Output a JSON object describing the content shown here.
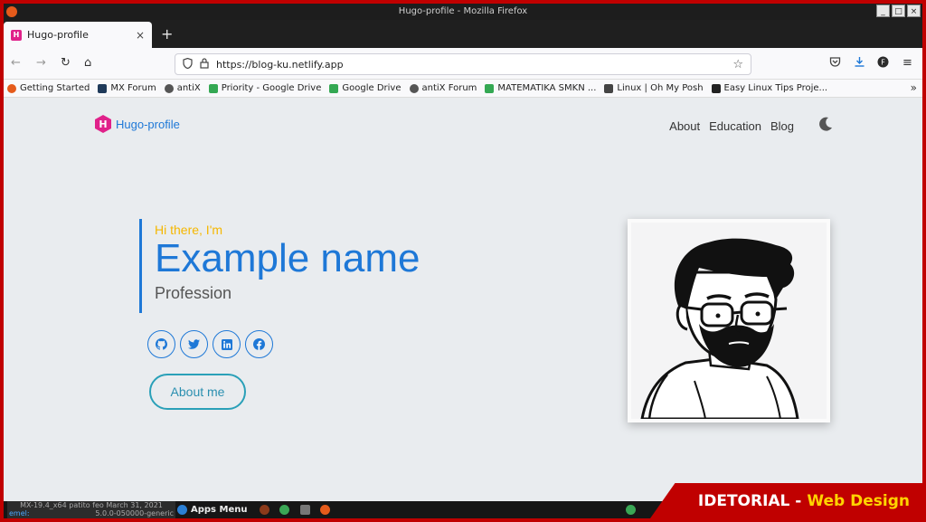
{
  "window": {
    "title": "Hugo-profile - Mozilla Firefox",
    "minimize": "_",
    "maximize": "□",
    "close": "×"
  },
  "tab": {
    "title": "Hugo-profile",
    "favicon_letter": "H",
    "close": "×",
    "new_tab": "+"
  },
  "nav": {
    "back": "←",
    "forward": "→",
    "reload": "↻",
    "home": "⌂",
    "url": "https://blog-ku.netlify.app",
    "menu": "≡"
  },
  "bookmarks": [
    {
      "label": "Getting Started",
      "icon": "firefox-icon",
      "color": "#e55b1b"
    },
    {
      "label": "MX Forum",
      "icon": "mx-icon",
      "color": "#1f3a5a"
    },
    {
      "label": "antiX",
      "icon": "globe-icon",
      "color": "#555555"
    },
    {
      "label": "Priority - Google Drive",
      "icon": "drive-icon",
      "color": "#34a853"
    },
    {
      "label": "Google Drive",
      "icon": "drive-icon",
      "color": "#34a853"
    },
    {
      "label": "antiX Forum",
      "icon": "globe-icon",
      "color": "#555555"
    },
    {
      "label": "MATEMATIKA SMKN ...",
      "icon": "drive-icon",
      "color": "#34a853"
    },
    {
      "label": "Linux | Oh My Posh",
      "icon": "terminal-icon",
      "color": "#444444"
    },
    {
      "label": "Easy Linux Tips Proje...",
      "icon": "tux-icon",
      "color": "#222222"
    }
  ],
  "bookmarks_more": "»",
  "site": {
    "brand": "Hugo-profile",
    "brand_letter": "H",
    "menu": [
      "About",
      "Education",
      "Blog"
    ],
    "greeting": "Hi there, I'm",
    "name": "Example name",
    "profession": "Profession",
    "socials": [
      "github",
      "twitter",
      "linkedin",
      "facebook"
    ],
    "about_button": "About me"
  },
  "taskbar": {
    "sysinfo_line1": "MX-19.4_x64 patito feo March 31, 2021",
    "sysinfo_left": "emel:",
    "sysinfo_right": "5.0.0-050000-generic",
    "apps_menu": "Apps Menu"
  },
  "watermark": {
    "prefix": "IDETORIAL -",
    "highlight": "Web Design"
  },
  "colors": {
    "accent": "#1e78d7",
    "greeting": "#f5b700",
    "brand_logo": "#e0218a",
    "frame": "#c00000"
  }
}
